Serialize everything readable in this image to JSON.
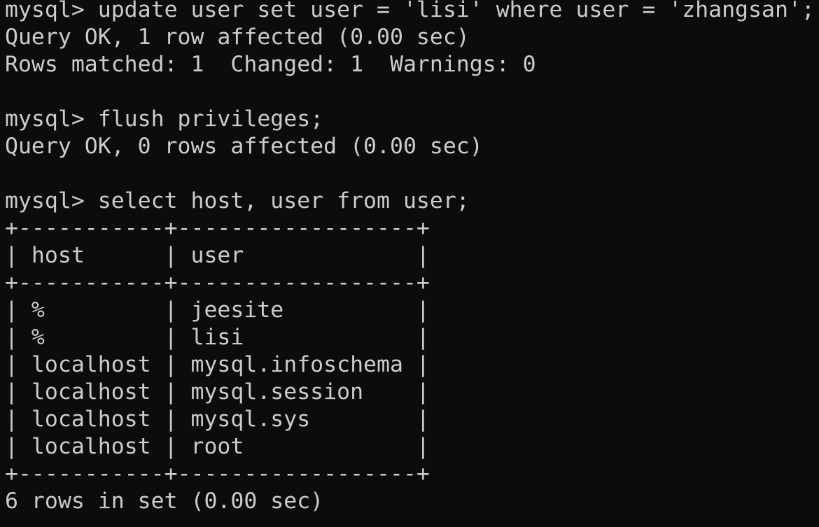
{
  "terminal": {
    "lines": [
      {
        "kind": "command",
        "text": "mysql> update user set user = 'lisi' where user = 'zhangsan';"
      },
      {
        "kind": "output",
        "text": "Query OK, 1 row affected (0.00 sec)"
      },
      {
        "kind": "output",
        "text": "Rows matched: 1  Changed: 1  Warnings: 0"
      },
      {
        "kind": "blank",
        "text": ""
      },
      {
        "kind": "command",
        "text": "mysql> flush privileges;"
      },
      {
        "kind": "output",
        "text": "Query OK, 0 rows affected (0.00 sec)"
      },
      {
        "kind": "blank",
        "text": ""
      },
      {
        "kind": "command",
        "text": "mysql> select host, user from user;"
      },
      {
        "kind": "table",
        "text": "+-----------+------------------+"
      },
      {
        "kind": "table",
        "text": "| host      | user             |"
      },
      {
        "kind": "table",
        "text": "+-----------+------------------+"
      },
      {
        "kind": "table",
        "text": "| %         | jeesite          |"
      },
      {
        "kind": "table",
        "text": "| %         | lisi             |"
      },
      {
        "kind": "table",
        "text": "| localhost | mysql.infoschema |"
      },
      {
        "kind": "table",
        "text": "| localhost | mysql.session    |"
      },
      {
        "kind": "table",
        "text": "| localhost | mysql.sys        |"
      },
      {
        "kind": "table",
        "text": "| localhost | root             |"
      },
      {
        "kind": "table",
        "text": "+-----------+------------------+"
      },
      {
        "kind": "output",
        "text": "6 rows in set (0.00 sec)"
      }
    ]
  },
  "colors": {
    "background": "#0c0c0c",
    "foreground": "#cccccc"
  }
}
